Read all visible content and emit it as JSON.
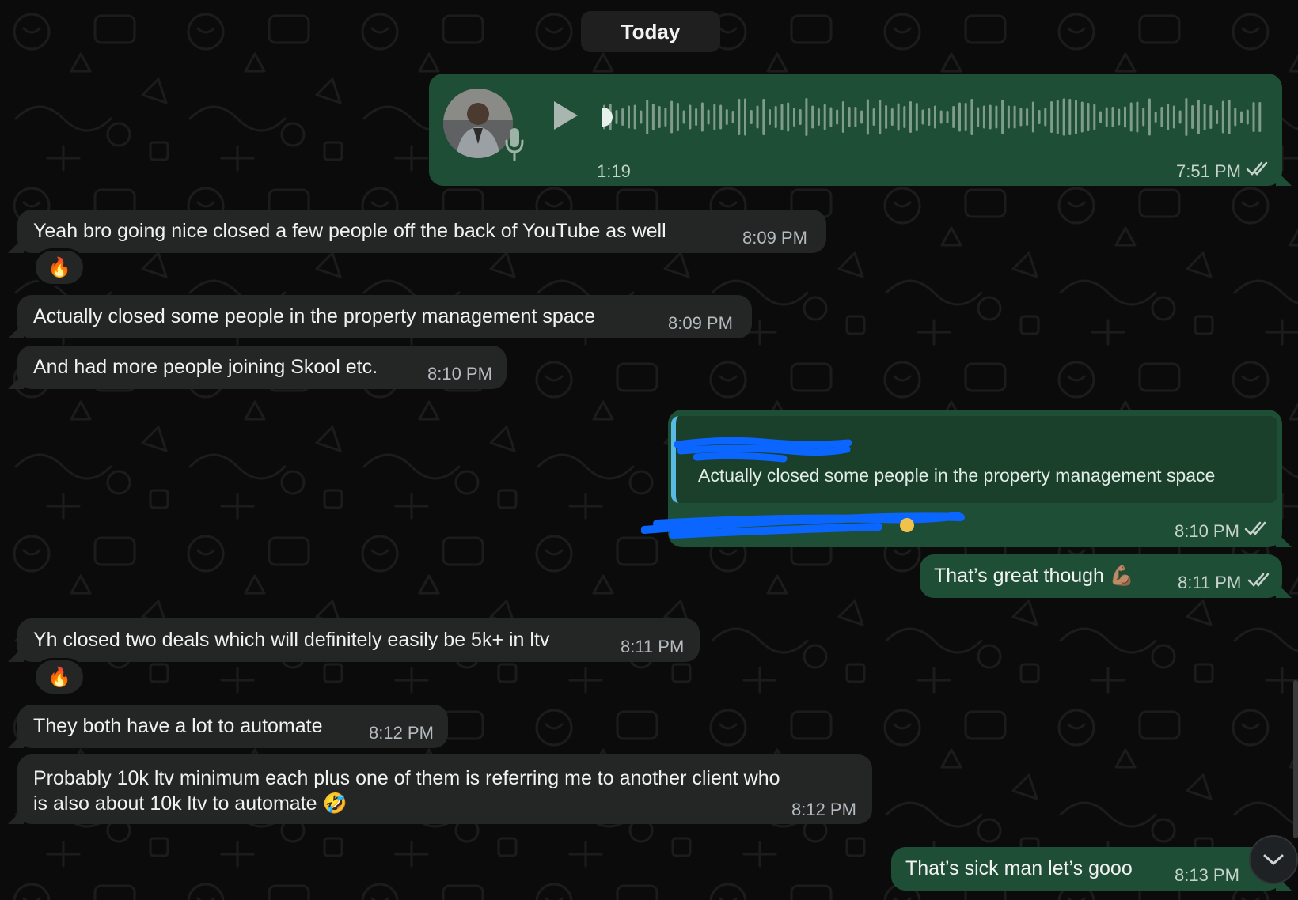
{
  "date_divider": "Today",
  "voice_message": {
    "duration": "1:19",
    "time": "7:51 PM",
    "progress": 0
  },
  "messages": [
    {
      "text": "Yeah bro going nice closed a few people off the back of YouTube as well",
      "time": "8:09 PM",
      "reaction": "🔥"
    },
    {
      "text": "Actually closed some people in the property management space",
      "time": "8:09 PM"
    },
    {
      "text": "And had more people joining Skool etc.",
      "time": "8:10 PM"
    },
    {
      "quoted_text": "Actually closed some people in the property management space",
      "time": "8:10 PM"
    },
    {
      "text": "That’s great though 💪🏽",
      "time": "8:11 PM"
    },
    {
      "text": "Yh closed two deals which will definitely easily be 5k+ in ltv",
      "time": "8:11 PM",
      "reaction": "🔥"
    },
    {
      "text": "They both have a lot to automate",
      "time": "8:12 PM"
    },
    {
      "line1": "Probably 10k ltv minimum each plus one of them is referring me to another client who",
      "line2": "is also about 10k ltv to automate 🤣",
      "time": "8:12 PM"
    },
    {
      "text": "That’s sick man let’s gooo",
      "time": "8:13 PM"
    }
  ],
  "colors": {
    "background": "#0b0b0b",
    "incoming_bubble": "#242626",
    "outgoing_bubble": "#1f4e36",
    "quote_bar": "#58b9e3",
    "read_ticks": "#c6d3cc",
    "redaction": "#0a66ff"
  },
  "icons": {
    "voice_play": "play-icon",
    "voice_mic": "microphone-icon",
    "read_status": "double-check-icon",
    "scroll": "chevron-down-icon"
  }
}
